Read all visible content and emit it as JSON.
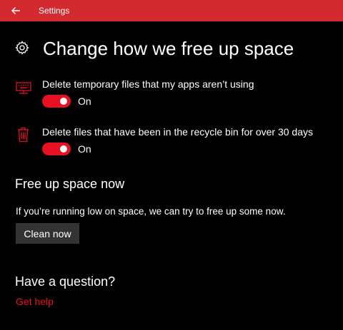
{
  "titlebar": {
    "title": "Settings",
    "back_icon": "back-arrow-icon"
  },
  "header": {
    "icon": "gear-icon",
    "title": "Change how we free up space"
  },
  "settings": [
    {
      "icon": "monitor-icon",
      "label": "Delete temporary files that my apps aren’t using",
      "toggle_on": true,
      "state_label": "On"
    },
    {
      "icon": "trash-icon",
      "label": "Delete files that have been in the recycle bin for over 30 days",
      "toggle_on": true,
      "state_label": "On"
    }
  ],
  "free_up_now": {
    "title": "Free up space now",
    "description": "If you’re running low on space, we can try to free up some now.",
    "button_label": "Clean now"
  },
  "question": {
    "title": "Have a question?",
    "link_label": "Get help"
  },
  "colors": {
    "titlebar": "#d22a2f",
    "accent": "#e81123",
    "background": "#000000",
    "button": "#333333"
  }
}
